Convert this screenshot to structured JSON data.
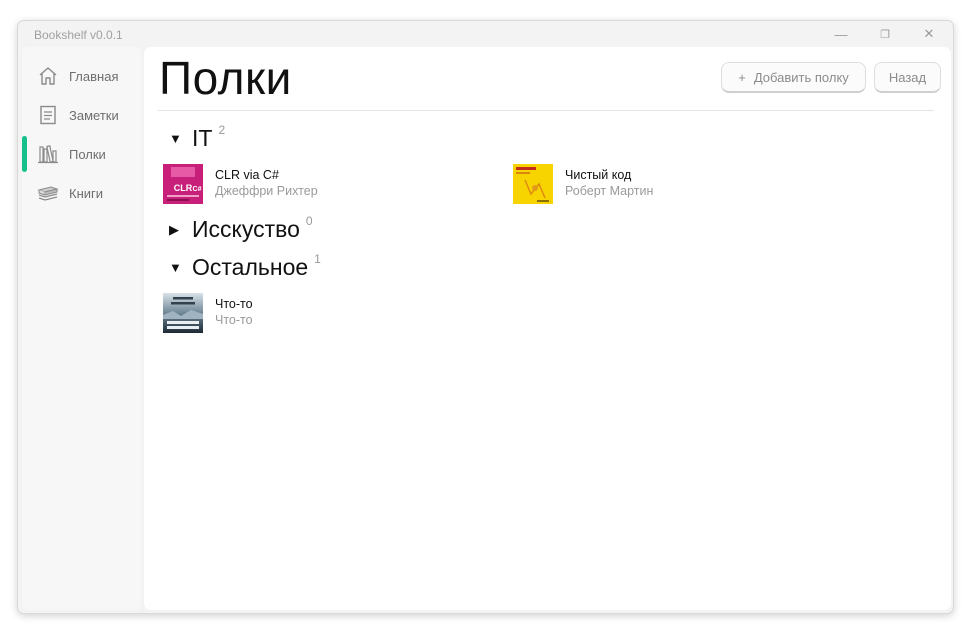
{
  "window": {
    "title": "Bookshelf v0.0.1",
    "controls": {
      "minimize": "—",
      "maximize": "❐",
      "close": "✕"
    }
  },
  "sidebar": {
    "items": [
      {
        "label": "Главная",
        "icon": "home-icon"
      },
      {
        "label": "Заметки",
        "icon": "notes-icon"
      },
      {
        "label": "Полки",
        "icon": "shelves-icon",
        "active": true
      },
      {
        "label": "Книги",
        "icon": "books-icon"
      }
    ],
    "accent_color": "#16c08a"
  },
  "main": {
    "title": "Полки",
    "add_button": {
      "icon": "+",
      "label": "Добавить полку"
    },
    "back_button": {
      "label": "Назад"
    },
    "shelves": [
      {
        "name": "IT",
        "count": "2",
        "expanded": true,
        "toggle": "▼",
        "books": [
          {
            "title": "CLR via C#",
            "author": "Джеффри Рихтер",
            "cover_color": "#c8207a"
          },
          {
            "title": "Чистый код",
            "author": "Роберт Мартин",
            "cover_color": "#f7d400"
          }
        ]
      },
      {
        "name": "Исскуство",
        "count": "0",
        "expanded": false,
        "toggle": "▶",
        "books": []
      },
      {
        "name": "Остальное",
        "count": "1",
        "expanded": true,
        "toggle": "▼",
        "books": [
          {
            "title": "Что-то",
            "author": "Что-то",
            "cover_color": "#2a3a48"
          }
        ]
      }
    ]
  }
}
